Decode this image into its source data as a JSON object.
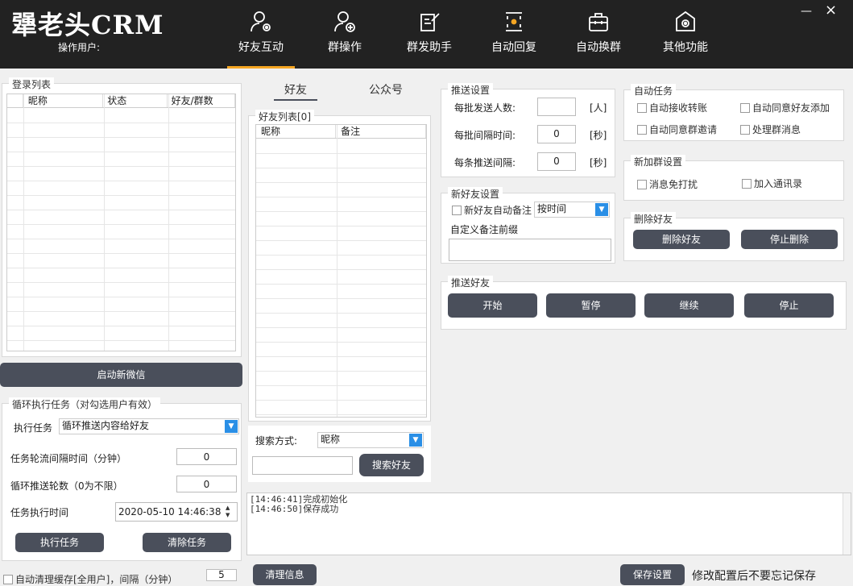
{
  "app": {
    "title": "犟老头CRM",
    "operator_label": "操作用户:"
  },
  "window": {
    "minimize": "—",
    "close": "×"
  },
  "nav": [
    {
      "label": "好友互动",
      "icon": "user-gear-icon",
      "active": true
    },
    {
      "label": "群操作",
      "icon": "user-plus-icon",
      "active": false
    },
    {
      "label": "群发助手",
      "icon": "edit-doc-icon",
      "active": false
    },
    {
      "label": "自动回复",
      "icon": "auto-reply-icon",
      "active": false
    },
    {
      "label": "自动换群",
      "icon": "briefcase-icon",
      "active": false
    },
    {
      "label": "其他功能",
      "icon": "gear-house-icon",
      "active": false
    }
  ],
  "login": {
    "title": "登录列表",
    "columns": [
      "昵称",
      "状态",
      "好友/群数"
    ],
    "start_button": "启动新微信"
  },
  "loop": {
    "title": "循环执行任务（对勾选用户有效）",
    "task_label": "执行任务",
    "task_value": "循环推送内容给好友",
    "interval_label": "任务轮流间隔时间（分钟）",
    "interval_value": "0",
    "rounds_label": "循环推送轮数（0为不限）",
    "rounds_value": "0",
    "time_label": "任务执行时间",
    "time_value": "2020-05-10 14:46:38",
    "exec_button": "执行任务",
    "clear_button": "清除任务",
    "cleanup_label": "自动清理缓存[全用户]，间隔（分钟）",
    "cleanup_value": "5"
  },
  "tabs": {
    "friends": "好友",
    "official": "公众号"
  },
  "friend_list": {
    "title": "好友列表[0]",
    "columns": [
      "昵称",
      "备注"
    ],
    "search_label": "搜索方式:",
    "search_mode": "昵称",
    "search_button": "搜索好友"
  },
  "push_settings": {
    "title": "推送设置",
    "batch_count_label": "每批发送人数:",
    "batch_count_value": "",
    "batch_count_unit": "[人]",
    "batch_interval_label": "每批间隔时间:",
    "batch_interval_value": "0",
    "batch_interval_unit": "[秒]",
    "item_interval_label": "每条推送间隔:",
    "item_interval_value": "0",
    "item_interval_unit": "[秒]"
  },
  "new_friend": {
    "title": "新好友设置",
    "auto_remark": "新好友自动备注",
    "remark_mode": "按时间",
    "prefix_label": "自定义备注前缀"
  },
  "auto_task": {
    "title": "自动任务",
    "items": [
      "自动接收转账",
      "自动同意好友添加",
      "自动同意群邀请",
      "处理群消息"
    ]
  },
  "new_group": {
    "title": "新加群设置",
    "items": [
      "消息免打扰",
      "加入通讯录"
    ]
  },
  "delete_friend": {
    "title": "删除好友",
    "delete_button": "删除好友",
    "stop_button": "停止删除"
  },
  "push_friend": {
    "title": "推送好友",
    "buttons": [
      "开始",
      "暂停",
      "继续",
      "停止"
    ]
  },
  "log": {
    "lines": [
      "[14:46:41]完成初始化",
      "[14:46:50]保存成功"
    ],
    "clear_button": "清理信息",
    "save_button": "保存设置",
    "save_hint": "修改配置后不要忘记保存"
  }
}
